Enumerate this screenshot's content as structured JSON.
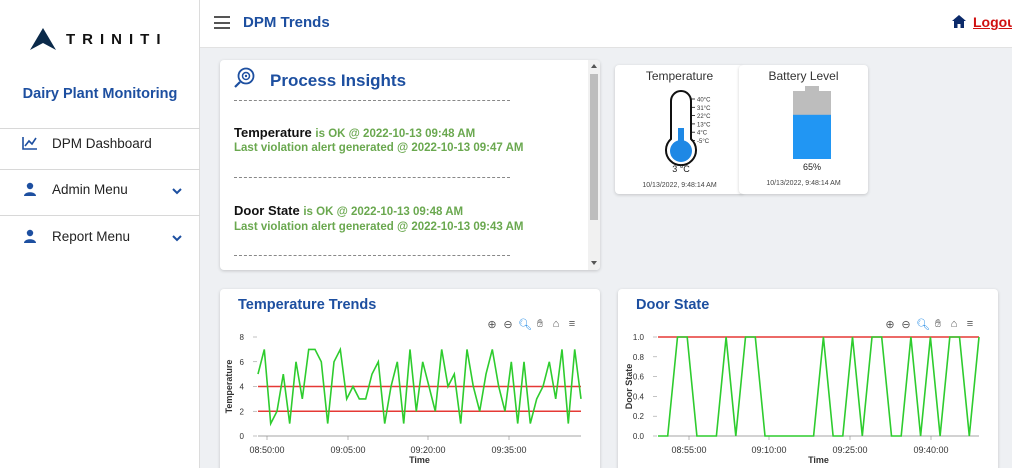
{
  "brand": {
    "logo_text": "TRINITI",
    "app_title": "Dairy Plant Monitoring"
  },
  "sidebar": {
    "items": [
      {
        "label": "DPM Dashboard",
        "icon": "chart-line-icon"
      },
      {
        "label": "Admin Menu",
        "icon": "user-icon",
        "expandable": true
      },
      {
        "label": "Report Menu",
        "icon": "user-icon",
        "expandable": true
      }
    ]
  },
  "header": {
    "title": "DPM Trends",
    "logout_label": "Logout"
  },
  "insights": {
    "title": "Process Insights",
    "entries": [
      {
        "name": "Temperature",
        "status": "is OK @ 2022-10-13 09:48 AM",
        "alert": "Last violation alert generated @ 2022-10-13 09:47 AM"
      },
      {
        "name": "Door State",
        "status": "is OK @ 2022-10-13 09:48 AM",
        "alert": "Last violation alert generated @ 2022-10-13 09:43 AM"
      }
    ]
  },
  "temperature_gauge": {
    "title": "Temperature",
    "value_text": "3 °C",
    "value": 3,
    "scale_labels": [
      "40°C",
      "31°C",
      "22°C",
      "13°C",
      "4°C",
      "-5°C"
    ],
    "timestamp": "10/13/2022, 9:48:14 AM",
    "color": "#1e88e5"
  },
  "battery_gauge": {
    "title": "Battery Level",
    "value_text": "65%",
    "level": 0.65,
    "timestamp": "10/13/2022, 9:48:14 AM",
    "color": "#2196f3"
  },
  "chart_data": [
    {
      "type": "line",
      "title": "Temperature Trends",
      "xlabel": "Time",
      "ylabel": "Temperature",
      "ylim": [
        0,
        8
      ],
      "yticks": [
        "8",
        "6",
        "4",
        "2",
        "0"
      ],
      "xticks": [
        "08:50:00",
        "09:05:00",
        "09:20:00",
        "09:35:00"
      ],
      "series": [
        {
          "color": "#2ecc2e",
          "values": [
            5,
            7,
            1,
            2,
            5,
            1,
            6,
            3,
            7,
            7,
            6,
            1,
            6,
            7,
            3,
            4,
            3,
            3,
            5,
            6,
            1,
            4,
            6,
            1,
            7,
            2,
            6,
            4,
            2,
            7,
            4,
            5,
            1,
            7,
            4,
            2,
            5,
            7,
            4,
            2,
            6,
            1,
            6,
            1,
            3,
            4,
            6,
            3,
            7,
            1,
            7,
            3
          ]
        }
      ],
      "thresholds": [
        {
          "value": 4,
          "color": "#e53935"
        },
        {
          "value": 2,
          "color": "#e53935"
        }
      ]
    },
    {
      "type": "line",
      "title": "Door State",
      "xlabel": "Time",
      "ylabel": "Door State",
      "ylim": [
        0,
        1
      ],
      "yticks": [
        "1.0",
        "0.8",
        "0.6",
        "0.4",
        "0.2",
        "0.0"
      ],
      "xticks": [
        "08:55:00",
        "09:10:00",
        "09:25:00",
        "09:40:00"
      ],
      "series": [
        {
          "color": "#2ecc2e",
          "values": [
            0,
            0,
            1,
            1,
            0,
            0,
            0,
            1,
            0,
            1,
            1,
            0,
            0,
            0,
            0,
            0,
            0,
            1,
            0,
            0,
            1,
            0,
            1,
            1,
            0,
            0,
            1,
            0,
            1,
            0,
            1,
            1,
            0,
            1
          ]
        }
      ],
      "thresholds": [
        {
          "value": 1,
          "color": "#e53935"
        }
      ]
    }
  ]
}
